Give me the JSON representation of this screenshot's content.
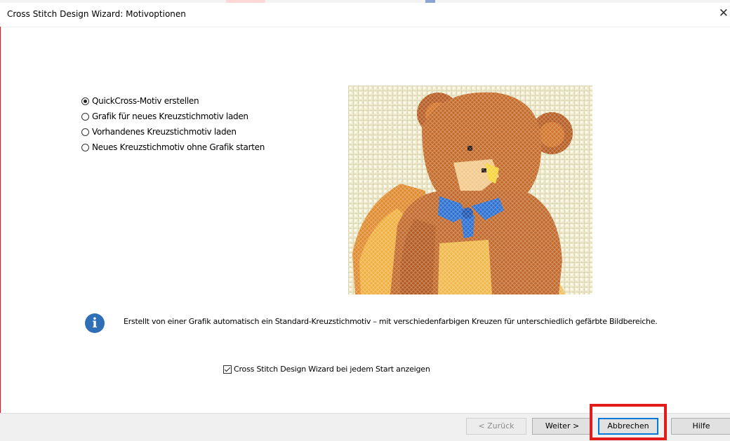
{
  "window": {
    "title": "Cross Stitch Design Wizard: Motivoptionen",
    "close_glyph": "✕"
  },
  "options": [
    {
      "label": "QuickCross-Motiv erstellen",
      "checked": true
    },
    {
      "label": "Grafik für neues Kreuzstichmotiv laden",
      "checked": false
    },
    {
      "label": "Vorhandenes Kreuzstichmotiv laden",
      "checked": false
    },
    {
      "label": "Neues Kreuzstichmotiv ohne Grafik starten",
      "checked": false
    }
  ],
  "preview": {
    "icon": "teddy-bear-cross-stitch-image"
  },
  "info": {
    "icon": "info-icon",
    "glyph": "i",
    "text": "Erstellt von einer Grafik automatisch ein Standard-Kreuzstichmotiv – mit verschiedenfarbigen Kreuzen für unterschiedlich gefärbte Bildbereiche."
  },
  "startup_checkbox": {
    "label": "Cross Stitch Design Wizard bei jedem Start anzeigen",
    "checked": true
  },
  "buttons": {
    "back": "< Zurück",
    "next": "Weiter >",
    "cancel": "Abbrechen",
    "help": "Hilfe"
  },
  "colors": {
    "accent_red": "#e21b1b",
    "info_blue": "#2e6fb7",
    "focus_blue": "#0078d7"
  }
}
